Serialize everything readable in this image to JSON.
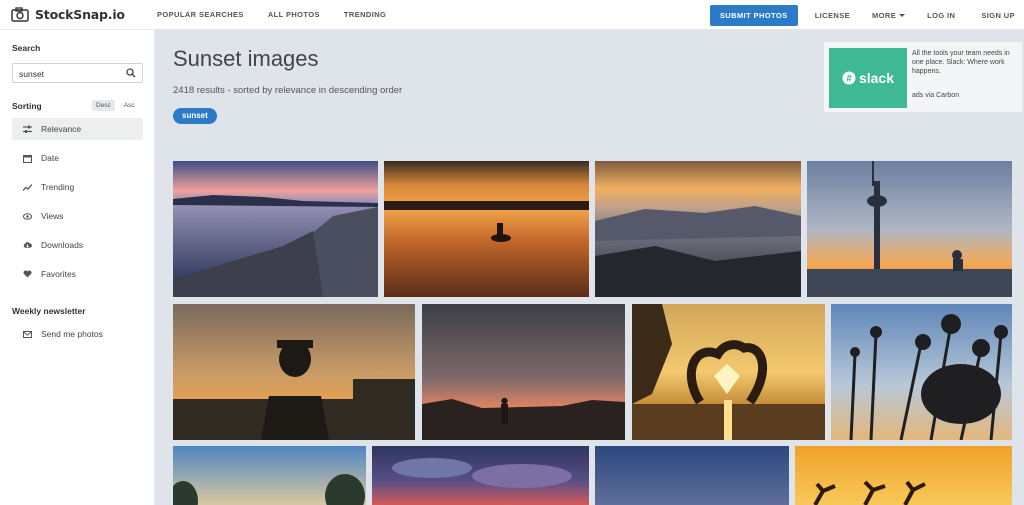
{
  "header": {
    "logo_text": "StockSnap.io",
    "nav_left": [
      "POPULAR SEARCHES",
      "ALL PHOTOS",
      "TRENDING"
    ],
    "submit_label": "SUBMIT PHOTOS",
    "license_label": "LICENSE",
    "more_label": "MORE",
    "login_label": "LOG IN",
    "signup_label": "SIGN UP"
  },
  "sidebar": {
    "search_label": "Search",
    "search_value": "sunset",
    "sorting_label": "Sorting",
    "sort_desc": "Desc",
    "sort_asc": "Asc",
    "sort_items": [
      {
        "label": "Relevance",
        "icon": "sliders-icon",
        "active": true
      },
      {
        "label": "Date",
        "icon": "calendar-icon"
      },
      {
        "label": "Trending",
        "icon": "trending-icon"
      },
      {
        "label": "Views",
        "icon": "eye-icon"
      },
      {
        "label": "Downloads",
        "icon": "cloud-download-icon"
      },
      {
        "label": "Favorites",
        "icon": "heart-icon"
      }
    ],
    "newsletter_label": "Weekly newsletter",
    "newsletter_item": {
      "label": "Send me photos",
      "icon": "envelope-icon"
    }
  },
  "main": {
    "title": "Sunset images",
    "results_text": "2418 results - sorted by relevance in descending order",
    "tag": "sunset"
  },
  "ad": {
    "brand": "slack",
    "text": "All the tools your team needs in one place. Slack: Where work happens.",
    "via": "ads via Carbon"
  },
  "colors": {
    "accent": "#2b7bc8",
    "background": "#dfe3ea",
    "slack_green": "#3eb991"
  }
}
